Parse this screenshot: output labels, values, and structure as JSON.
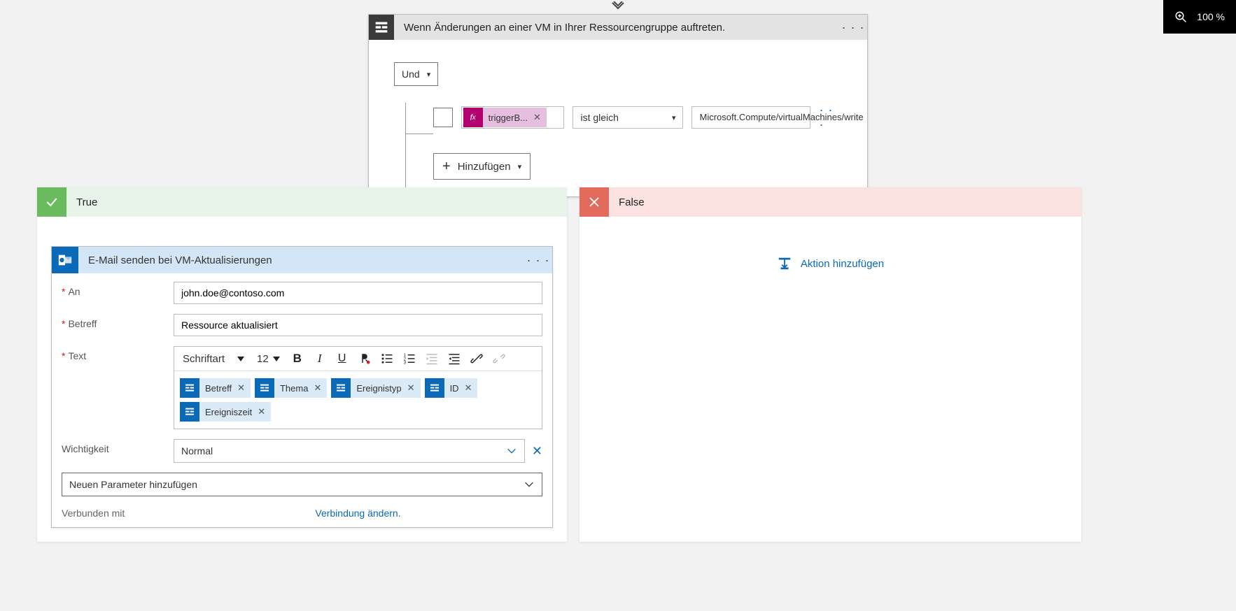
{
  "zoom": {
    "value": "100 %"
  },
  "trigger": {
    "title": "Wenn Änderungen an einer VM in Ihrer Ressourcengruppe auftreten.",
    "and_label": "Und",
    "condition": {
      "fx_label": "triggerB...",
      "operator": "ist gleich",
      "value": "Microsoft.Compute/virtualMachines/write"
    },
    "add_label": "Hinzufügen"
  },
  "branches": {
    "true_label": "True",
    "false_label": "False"
  },
  "email_action": {
    "title": "E-Mail senden bei VM-Aktualisierungen",
    "fields": {
      "to_label": "An",
      "to_value": "john.doe@contoso.com",
      "subject_label": "Betreff",
      "subject_value": "Ressource aktualisiert",
      "body_label": "Text",
      "importance_label": "Wichtigkeit",
      "importance_value": "Normal",
      "add_param_label": "Neuen Parameter hinzufügen",
      "connected_label": "Verbunden mit",
      "change_conn_label": "Verbindung ändern."
    },
    "toolbar": {
      "font_label": "Schriftart",
      "size_label": "12"
    },
    "body_tokens": [
      {
        "label": "Betreff"
      },
      {
        "label": "Thema"
      },
      {
        "label": "Ereignistyp"
      },
      {
        "label": "ID"
      },
      {
        "label": "Ereigniszeit"
      }
    ]
  },
  "false_branch": {
    "add_action_label": "Aktion hinzufügen"
  }
}
